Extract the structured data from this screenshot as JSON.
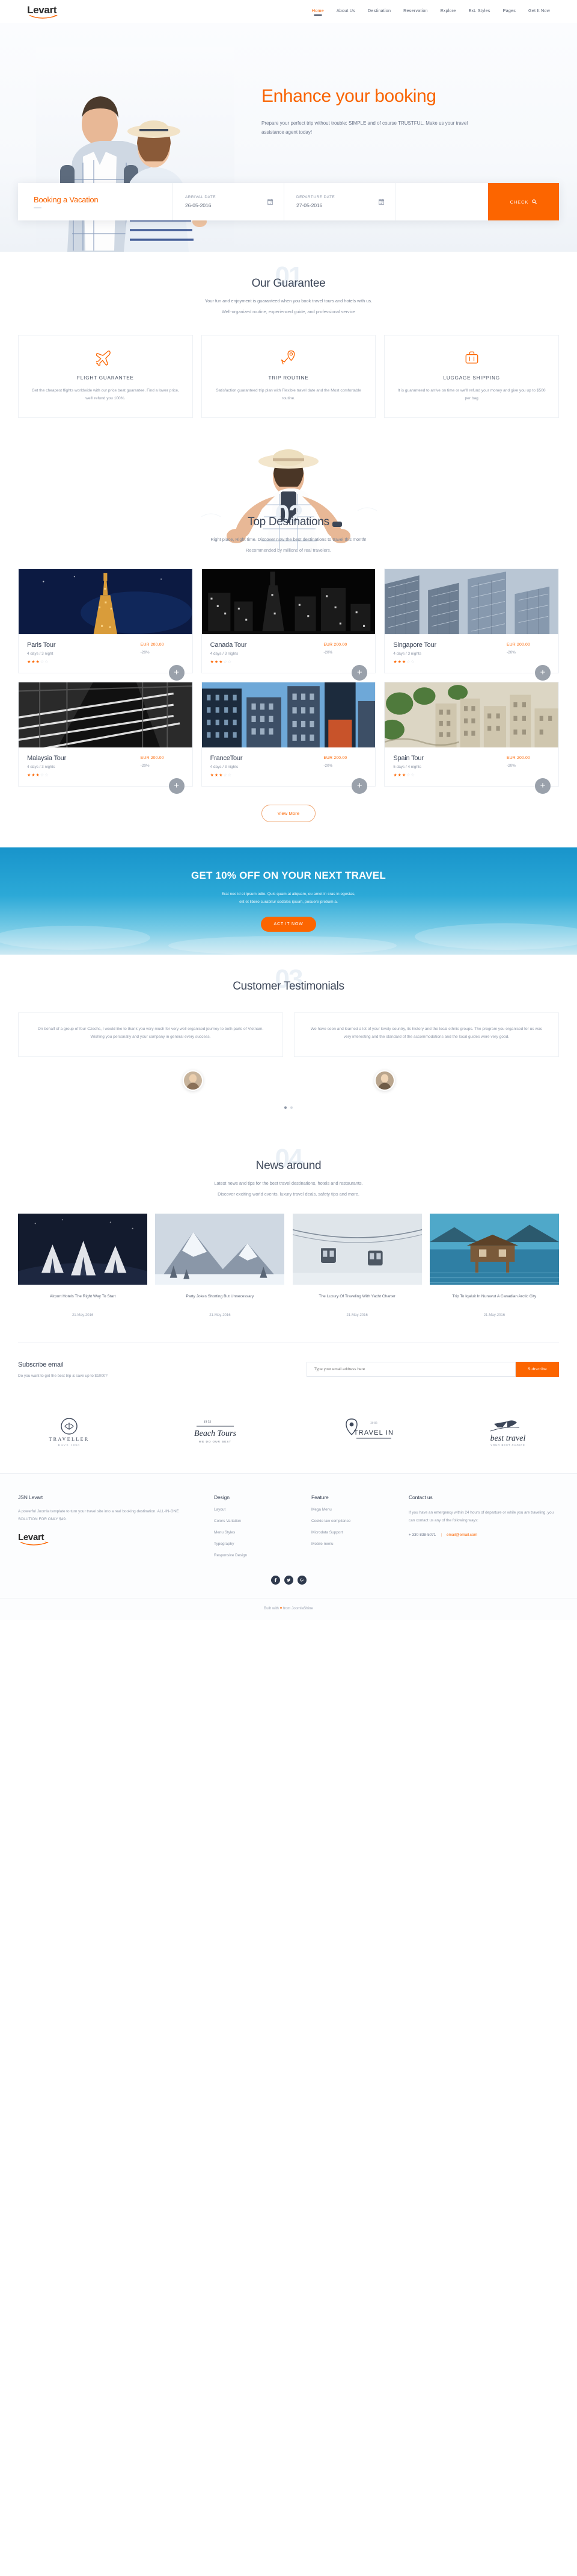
{
  "header": {
    "logo": "Levart",
    "nav": [
      {
        "label": "Home",
        "active": true
      },
      {
        "label": "About Us",
        "active": false
      },
      {
        "label": "Destination",
        "active": false
      },
      {
        "label": "Reservation",
        "active": false
      },
      {
        "label": "Explore",
        "active": false
      },
      {
        "label": "Ext. Styles",
        "active": false
      },
      {
        "label": "Pages",
        "active": false
      },
      {
        "label": "Get It Now",
        "active": false
      }
    ]
  },
  "hero": {
    "title": "Enhance your booking",
    "subtitle": "Prepare your perfect trip without trouble: SIMPLE and of course TRUSTFUL. Make us your travel assistance agent today!",
    "booking": {
      "label": "Booking a Vacation",
      "arrival_label": "ARRIVAL DATE",
      "arrival_value": "26-05-2016",
      "departure_label": "DEPARTURE DATE",
      "departure_value": "27-05-2016",
      "check_label": "CHECK"
    }
  },
  "guarantee": {
    "watermark": "01",
    "title": "Our Guarantee",
    "subtitle": "Your fun and enjoyment is guaranteed when you book travel tours and hotels with us.",
    "subtitle2": "Well-organized routine, experienced guide, and professional service",
    "cards": [
      {
        "icon": "airplane-icon",
        "title": "FLIGHT GUARANTEE",
        "desc": "Get the cheapest flights worldwide with our price beat guarantee. Find a lower price, we'll refund you 100%."
      },
      {
        "icon": "route-pin-icon",
        "title": "TRIP ROUTINE",
        "desc": "Satisfaction guaranteed trip plan with Flexible travel date and the Most comfortable routine."
      },
      {
        "icon": "luggage-icon",
        "title": "LUGGAGE SHIPPING",
        "desc": "It is guaranteed to arrive on time or we'll refund your money and give you up to $500 per bag"
      }
    ]
  },
  "destinations": {
    "watermark": "02",
    "title": "Top Destinations",
    "subtitle": "Right place, Right time. Discover now the best destinations to travel this month!",
    "subtitle2": "Recommended by millions of real travelers.",
    "view_more": "View More",
    "tours": [
      {
        "name": "Paris Tour",
        "duration": "4 days / 3 night",
        "price": "EUR 200.00",
        "discount": "-20%",
        "stars": 3,
        "theme": "paris"
      },
      {
        "name": "Canada Tour",
        "duration": "4 days / 3 nights",
        "price": "EUR 200.00",
        "discount": "-20%",
        "stars": 3,
        "theme": "canada"
      },
      {
        "name": "Singapore Tour",
        "duration": "4 days / 3 nights",
        "price": "EUR 200.00",
        "discount": "-20%",
        "stars": 3,
        "theme": "singapore"
      },
      {
        "name": "Malaysia Tour",
        "duration": "4 days / 3 nights",
        "price": "EUR 200.00",
        "discount": "-20%",
        "stars": 3,
        "theme": "malaysia"
      },
      {
        "name": "FranceTour",
        "duration": "4 days / 3 nights",
        "price": "EUR 200.00",
        "discount": "-20%",
        "stars": 3,
        "theme": "france"
      },
      {
        "name": "Spain Tour",
        "duration": "5 days / 4 nights",
        "price": "EUR 200.00",
        "discount": "-20%",
        "stars": 3,
        "theme": "spain"
      }
    ]
  },
  "promo": {
    "title": "GET 10% OFF ON YOUR NEXT TRAVEL",
    "line1": "Erat nec id et ipsum odio. Quis quam at aliquam, eu amet in cras in egestas,",
    "line2": "elit et libero curabitur sodales ipsum, posuere pretium a.",
    "button": "ACT IT NOW"
  },
  "testimonials": {
    "watermark": "03",
    "title": "Customer Testimonials",
    "items": [
      {
        "text": "On behalf of a group of four Czechs, I would like to thank you very much for very well organised journey to both parts of Vietnam. Wishing you personally and your company in general every success."
      },
      {
        "text": "We have seen and learned a lot of your lovely country, its history and the local ethnic groups. The program you organised for us was very interesting and the standard of the accommodations and the local guides were very good."
      }
    ]
  },
  "news": {
    "watermark": "04",
    "title": "News around",
    "subtitle": "Latest news and tips for the best travel destinations, hotels and restaurants.",
    "subtitle2": "Discover exciting world events, luxury travel deals, safety tips and more.",
    "items": [
      {
        "title": "Airport Hotels The Right Way To Start",
        "date": "21-May-2016",
        "theme": "tents"
      },
      {
        "title": "Party Jokes Shorting But Unnecessary",
        "date": "21-May-2016",
        "theme": "mountain"
      },
      {
        "title": "The Luxury Of Traveling With Yacht Charter",
        "date": "21-May-2016",
        "theme": "cable"
      },
      {
        "title": "Trip To Iqaluit In Nunavut A Canadian Arctic City",
        "date": "21-May-2016",
        "theme": "lake"
      }
    ]
  },
  "subscribe": {
    "title": "Subscribe email",
    "subtitle": "Do you want to get the best trip & save up to $1000?",
    "placeholder": "Type your email address here",
    "button": "Subscribe"
  },
  "partners": [
    {
      "name": "TRAVELLER",
      "sub": "RAVE 1890"
    },
    {
      "name": "Beach Tours",
      "sub": "WE DO OUR BEST",
      "badge": "19 32"
    },
    {
      "name": "TRAVEL IN",
      "sub": "",
      "badge": "20 83"
    },
    {
      "name": "best travel",
      "sub": "YOUR BEST CHOICE"
    }
  ],
  "footer": {
    "about": {
      "title": "JSN Levart",
      "desc": "A powerful Joomla template to turn your travel site into a real booking destination. ALL-IN-ONE SOLUTION FOR ONLY $49.",
      "logo": "Levart"
    },
    "design": {
      "title": "Design",
      "links": [
        "Layout",
        "Colors Variation",
        "Menu Styles",
        "Typography",
        "Responsive Design"
      ]
    },
    "feature": {
      "title": "Feature",
      "links": [
        "Mega Menu",
        "Cookie law compliance",
        "Microdata Support",
        "Mobile menu"
      ]
    },
    "contact": {
      "title": "Contact us",
      "desc": "If you have an emergency within 24 hours of departure or while you are traveling, you can contact us any of the following ways:",
      "phone": "+ 330-838-5071",
      "separator": "|",
      "email": "email@email.com"
    },
    "socials": [
      "facebook-icon",
      "twitter-icon",
      "google-plus-icon"
    ],
    "copyright_pre": "Built with",
    "copyright_heart": "♥",
    "copyright_post": "from JoomlaShine"
  },
  "colors": {
    "accent": "#fc6500",
    "accent_light": "#f96302",
    "dark": "#3d4759",
    "muted": "#8d96a6",
    "promo_blue": "#27a9d8"
  }
}
